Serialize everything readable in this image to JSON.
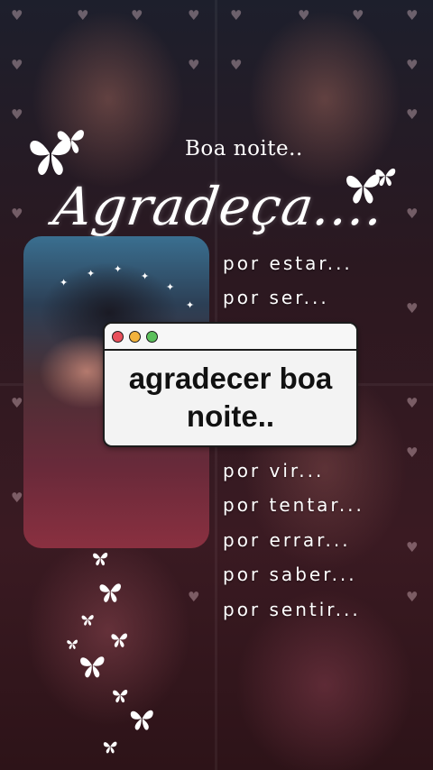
{
  "greeting": "Boa noite..",
  "headline": "Agradeça....",
  "reasons": [
    "por estar...",
    "por ser...",
    "por vir...",
    "por tentar...",
    "por errar...",
    "por saber...",
    "por sentir..."
  ],
  "search_window": {
    "query": "agradecer boa noite..",
    "buttons": [
      "close",
      "minimize",
      "maximize"
    ]
  },
  "colors": {
    "window_bg": "#f3f3f3",
    "close": "#e8505b",
    "minimize": "#f2b33d",
    "maximize": "#5bc05b",
    "text": "#ffffff"
  },
  "icons": [
    "heart-icon",
    "butterfly-icon",
    "sparkle-icon"
  ]
}
